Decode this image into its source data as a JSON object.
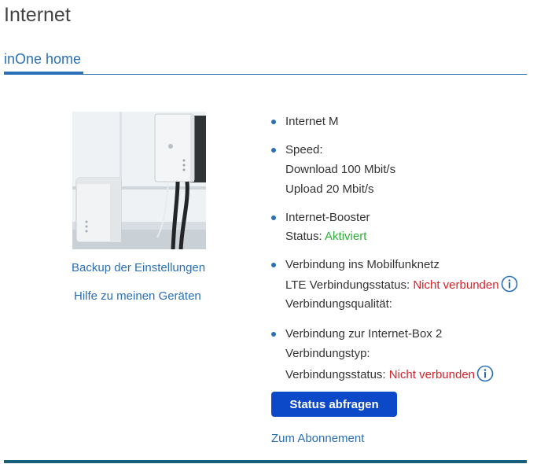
{
  "page": {
    "title": "Internet"
  },
  "tabs": [
    {
      "label": "inOne home",
      "active": true
    }
  ],
  "left": {
    "links": {
      "backup": "Backup der Einstellungen",
      "help": "Hilfe zu meinen Geräten"
    }
  },
  "details": {
    "product": "Internet M",
    "speed": {
      "label": "Speed:",
      "download": "Download 100 Mbit/s",
      "upload": "Upload 20 Mbit/s"
    },
    "booster": {
      "label": "Internet-Booster",
      "status_label": "Status: ",
      "status_value": "Aktiviert"
    },
    "mobile": {
      "label": "Verbindung ins Mobilfunknetz",
      "lte_label": "LTE Verbindungsstatus: ",
      "lte_value": "Nicht verbunden",
      "quality_label": "Verbindungsqualität:"
    },
    "box": {
      "label": "Verbindung zur Internet-Box 2",
      "type_label": "Verbindungstyp:",
      "status_label": "Verbindungsstatus: ",
      "status_value": "Nicht verbunden"
    }
  },
  "actions": {
    "status_button": "Status abfragen",
    "subscription_link": "Zum Abonnement"
  },
  "colors": {
    "accent": "#2a6fb8",
    "button": "#0c49c9",
    "ok": "#2fae3a",
    "error": "#d4232b"
  }
}
